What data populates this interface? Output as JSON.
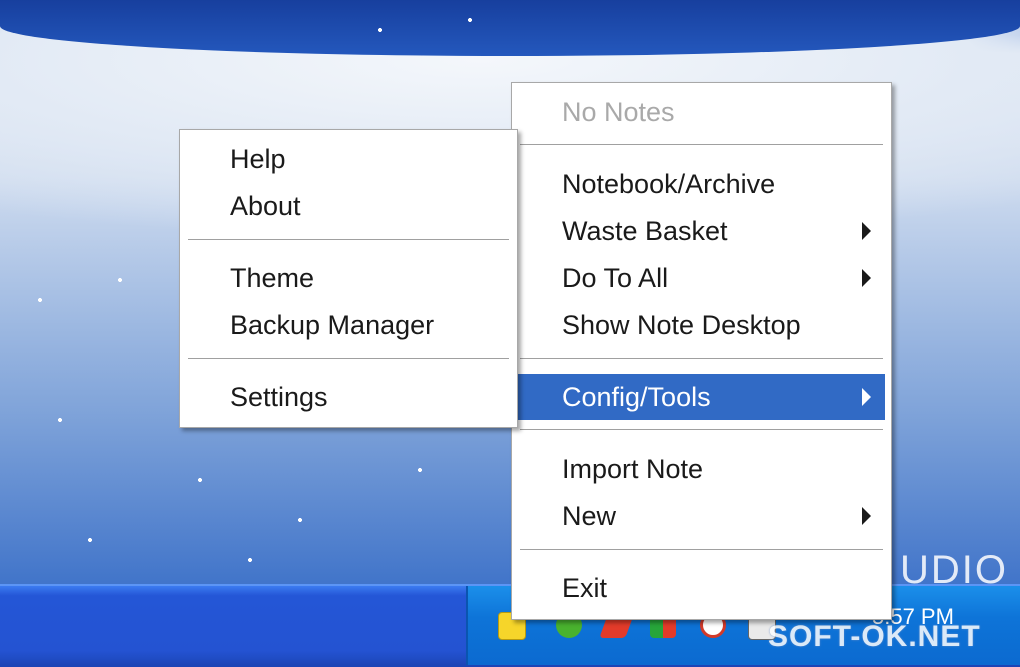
{
  "main_menu": {
    "items": [
      {
        "label": "No Notes"
      },
      {
        "label": "Notebook/Archive"
      },
      {
        "label": "Waste Basket"
      },
      {
        "label": "Do To All"
      },
      {
        "label": "Show Note Desktop"
      },
      {
        "label": "Config/Tools"
      },
      {
        "label": "Import Note"
      },
      {
        "label": "New"
      },
      {
        "label": "Exit"
      }
    ]
  },
  "submenu": {
    "items": [
      {
        "label": "Help"
      },
      {
        "label": "About"
      },
      {
        "label": "Theme"
      },
      {
        "label": "Backup Manager"
      },
      {
        "label": "Settings"
      }
    ]
  },
  "desktop": {
    "wallpaper_text": "UDIO"
  },
  "taskbar": {
    "clock": "5:57 PM",
    "tray_icons": [
      "sticky-note-icon",
      "green-circle-icon",
      "red-arrow-icon",
      "green-red-icon",
      "no-sign-icon",
      "keyboard-icon",
      "folder-icon"
    ]
  },
  "watermark": "SOFT-OK.NET",
  "colors": {
    "highlight": "#316ac5",
    "taskbar": "#2453d2",
    "tray": "#0e74d8"
  }
}
